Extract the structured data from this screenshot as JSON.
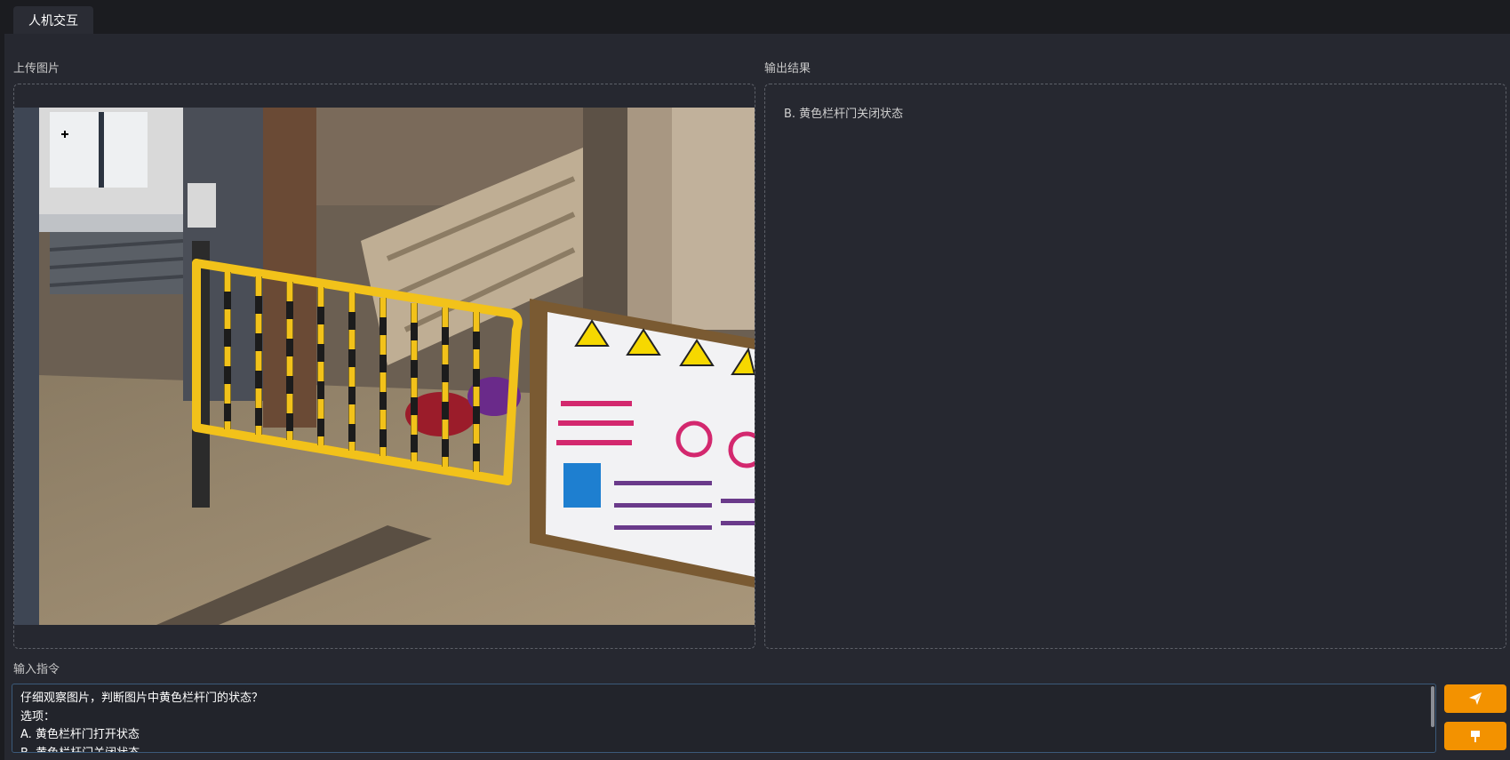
{
  "tabs": [
    {
      "label": "人机交互",
      "active": true
    }
  ],
  "upload": {
    "label": "上传图片"
  },
  "output": {
    "label": "输出结果",
    "result": "B. 黄色栏杆门关闭状态"
  },
  "input": {
    "label": "输入指令",
    "value": "仔细观察图片，判断图片中黄色栏杆门的状态？\n选项：\nA. 黄色栏杆门打开状态\nB. 黄色栏杆门关闭状态"
  },
  "buttons": {
    "send_icon": "send-icon",
    "clear_icon": "clear-icon"
  },
  "colors": {
    "accent": "#f39200",
    "panel": "#262830",
    "background": "#1b1c20",
    "gate": "#f2c21a"
  }
}
